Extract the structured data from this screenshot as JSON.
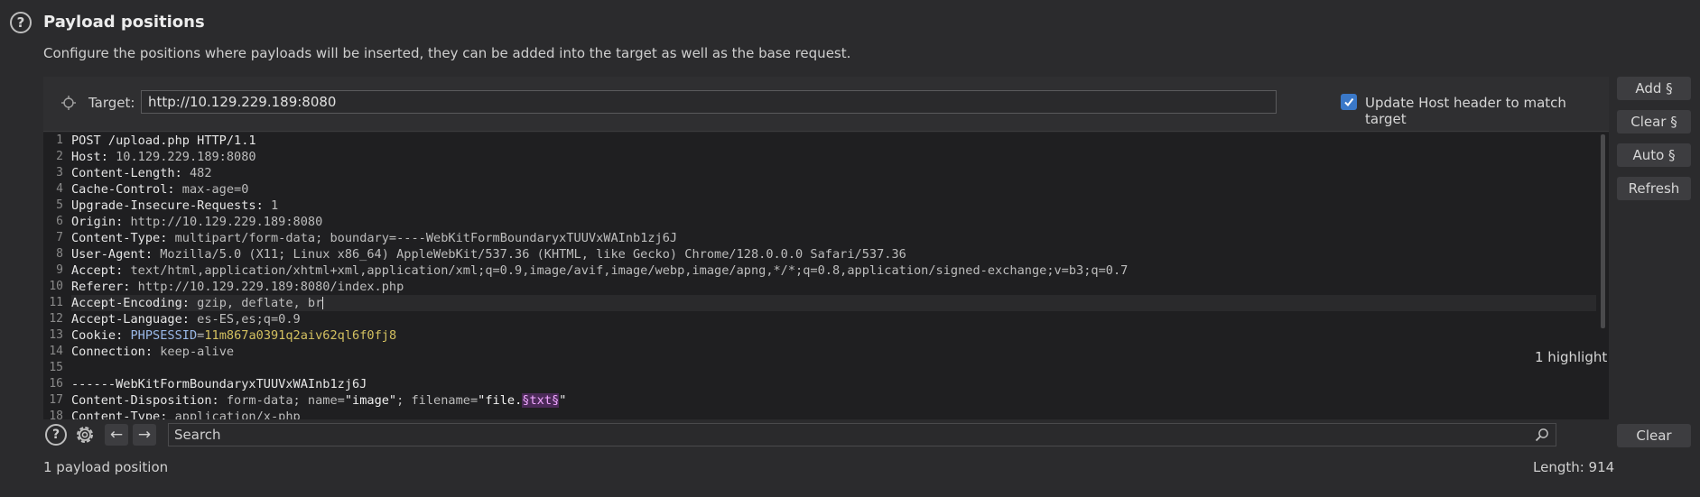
{
  "header": {
    "title": "Payload positions",
    "description": "Configure the positions where payloads will be inserted, they can be added into the target as well as the base request."
  },
  "target": {
    "label": "Target:",
    "value": "http://10.129.229.189:8080",
    "update_host_label": "Update Host header to match target",
    "update_host_checked": true
  },
  "side_buttons": {
    "add": "Add §",
    "clear_pos": "Clear §",
    "auto": "Auto §",
    "refresh": "Refresh",
    "clear": "Clear"
  },
  "editor": {
    "line_numbers": [
      "1",
      "2",
      "3",
      "4",
      "5",
      "6",
      "7",
      "8",
      "9",
      "10",
      "11",
      "12",
      "13",
      "14",
      "15",
      "16",
      "17",
      "18"
    ],
    "lines": {
      "l1": "POST /upload.php HTTP/1.1",
      "l2k": "Host:",
      "l2v": " 10.129.229.189:8080",
      "l3k": "Content-Length:",
      "l3v": " 482",
      "l4k": "Cache-Control:",
      "l4v": " max-age=0",
      "l5k": "Upgrade-Insecure-Requests:",
      "l5v": " 1",
      "l6k": "Origin:",
      "l6v": " http://10.129.229.189:8080",
      "l7k": "Content-Type:",
      "l7v": " multipart/form-data; boundary=----WebKitFormBoundaryxTUUVxWAInb1zj6J",
      "l8k": "User-Agent:",
      "l8v": " Mozilla/5.0 (X11; Linux x86_64) AppleWebKit/537.36 (KHTML, like Gecko) Chrome/128.0.0.0 Safari/537.36",
      "l9k": "Accept:",
      "l9v": " text/html,application/xhtml+xml,application/xml;q=0.9,image/avif,image/webp,image/apng,*/*;q=0.8,application/signed-exchange;v=b3;q=0.7",
      "l10k": "Referer:",
      "l10v": " http://10.129.229.189:8080/index.php",
      "l11k": "Accept-Encoding:",
      "l11v": " gzip, deflate, br",
      "l12k": "Accept-Language:",
      "l12v": " es-ES,es;q=0.9",
      "l13k": "Cookie:",
      "l13ck": "PHPSESSID",
      "l13eq": "=",
      "l13cv": "11m867a0391q2aiv62ql6f0fj8",
      "l14k": "Connection:",
      "l14v": " keep-alive",
      "l16": "------WebKitFormBoundaryxTUUVxWAInb1zj6J",
      "l17k": "Content-Disposition:",
      "l17a": " form-data; name=",
      "l17b": "\"image\"",
      "l17c": "; filename=",
      "l17d": "\"file.",
      "l17pos": "§txt§",
      "l17e": "\"",
      "l18k": "Content-Type:",
      "l18v": " application/x-php"
    }
  },
  "search": {
    "placeholder": "Search",
    "highlight_count": "1 highlight"
  },
  "status": {
    "payload_positions": "1 payload position",
    "length": "Length: 914"
  },
  "colors": {
    "checkbox": "#3a78c8",
    "payload_marker_bg": "#4b2a58",
    "payload_marker_fg": "#f0a6ff",
    "cookie_name": "#9bb9e8",
    "cookie_value": "#d3c060"
  }
}
